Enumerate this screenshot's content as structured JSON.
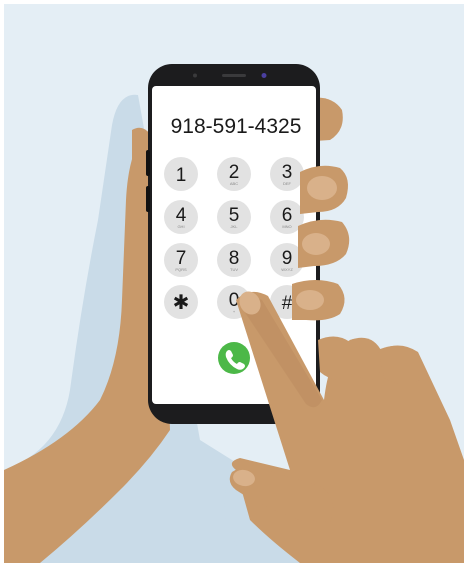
{
  "colors": {
    "background": "#e4eef5",
    "shadow": "#c9dbe8",
    "skin": "#c8996a",
    "skin_shade": "#b5855a",
    "nail": "#d9b18a",
    "phone_frame": "#1c1c1e",
    "screen": "#ffffff",
    "key": "#e2e2e2",
    "call_button": "#4cb848"
  },
  "dialer": {
    "phone_number": "918-591-4325",
    "keys": [
      {
        "digit": "1",
        "letters": ""
      },
      {
        "digit": "2",
        "letters": "ABC"
      },
      {
        "digit": "3",
        "letters": "DEF"
      },
      {
        "digit": "4",
        "letters": "GHI"
      },
      {
        "digit": "5",
        "letters": "JKL"
      },
      {
        "digit": "6",
        "letters": "MNO"
      },
      {
        "digit": "7",
        "letters": "PQRS"
      },
      {
        "digit": "8",
        "letters": "TUV"
      },
      {
        "digit": "9",
        "letters": "WXYZ"
      },
      {
        "digit": "✱",
        "letters": ""
      },
      {
        "digit": "0",
        "letters": "+"
      },
      {
        "digit": "#",
        "letters": ""
      }
    ],
    "call_icon": "phone-handset-icon"
  }
}
